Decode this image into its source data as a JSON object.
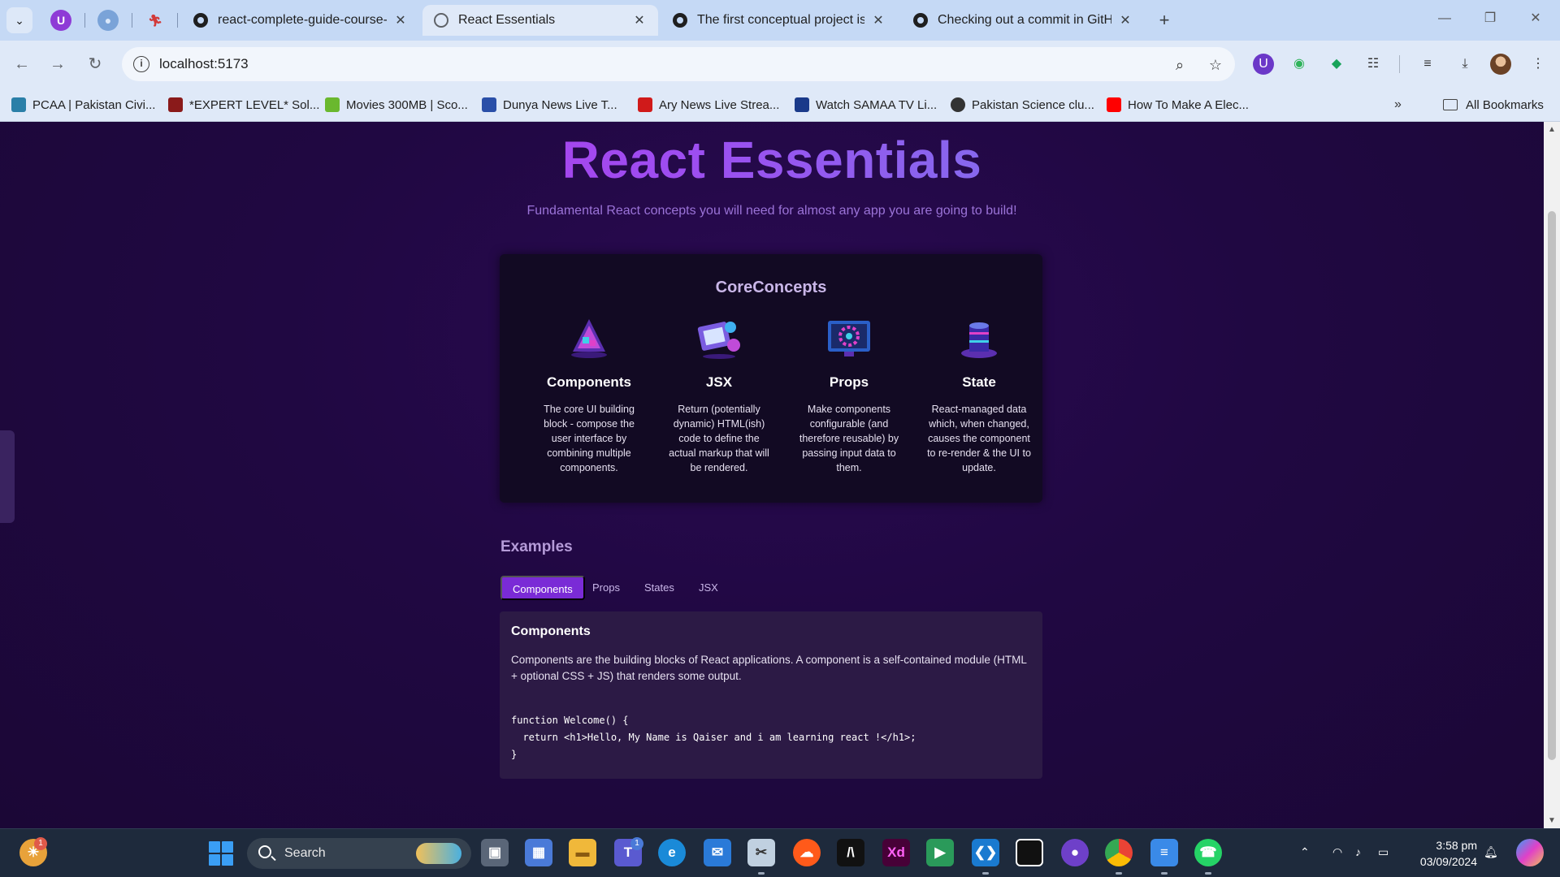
{
  "browser": {
    "tabs": [
      {
        "title": "react-complete-guide-course-r",
        "active": false
      },
      {
        "title": "React Essentials",
        "active": true
      },
      {
        "title": "The first conceptual project is c",
        "active": false
      },
      {
        "title": "Checking out a commit in GitHu",
        "active": false
      }
    ],
    "url": "localhost:5173",
    "bookmarks": [
      "PCAA | Pakistan Civi...",
      "*EXPERT LEVEL* Sol...",
      "Movies 300MB | Sco...",
      "Dunya News Live T...",
      "Ary News Live Strea...",
      "Watch SAMAA TV Li...",
      "Pakistan Science clu...",
      "How To Make A Elec..."
    ],
    "all_bookmarks": "All Bookmarks"
  },
  "page": {
    "title": "React Essentials",
    "subtitle": "Fundamental React concepts you will need for almost any app you are going to build!",
    "core_title": "CoreConcepts",
    "concepts": [
      {
        "title": "Components",
        "description": "The core UI building block - compose the user interface by combining multiple components."
      },
      {
        "title": "JSX",
        "description": "Return (potentially dynamic) HTML(ish) code to define the actual markup that will be rendered."
      },
      {
        "title": "Props",
        "description": "Make components configurable (and therefore reusable) by passing input data to them."
      },
      {
        "title": "State",
        "description": "React-managed data which, when changed, causes the component to re-render & the UI to update."
      }
    ],
    "examples_title": "Examples",
    "example_tabs": [
      "Components",
      "Props",
      "States",
      "JSX"
    ],
    "active_tab": "Components",
    "example": {
      "title": "Components",
      "description": "Components are the building blocks of React applications. A component is a self-contained module (HTML + optional CSS + JS) that renders some output.",
      "code": "function Welcome() {\n  return <h1>Hello, My Name is Qaiser and i am learning react !</h1>;\n}"
    }
  },
  "taskbar": {
    "search_placeholder": "Search",
    "widgets_badge": "1",
    "teams_badge": "1",
    "time": "3:58 pm",
    "date": "03/09/2024"
  },
  "colors": {
    "accent": "#7a2bd6",
    "title_gradient_start": "#c026e8",
    "title_gradient_end": "#5b9ae8",
    "background": "#200842"
  }
}
